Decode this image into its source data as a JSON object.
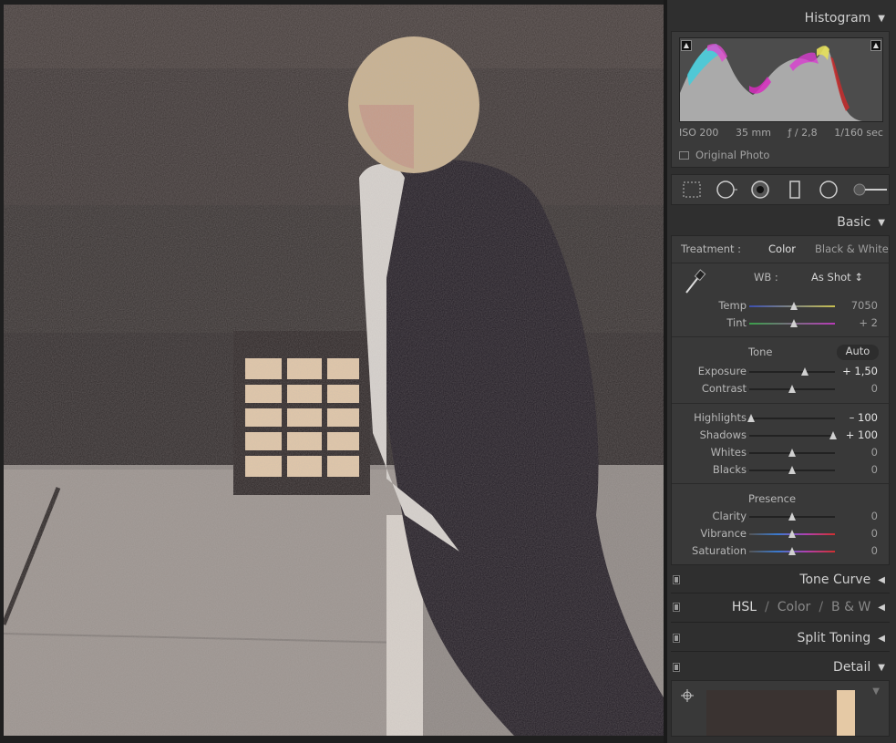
{
  "histogram": {
    "title": "Histogram",
    "exif": {
      "iso": "ISO 200",
      "focal": "35 mm",
      "aperture": "ƒ / 2,8",
      "shutter": "1/160 sec"
    },
    "original_photo_label": "Original Photo"
  },
  "basic": {
    "title": "Basic",
    "treatment_label": "Treatment :",
    "treatment_color": "Color",
    "treatment_bw": "Black & White",
    "wb_label": "WB :",
    "wb_value": "As Shot ↕",
    "tone_label": "Tone",
    "auto_label": "Auto",
    "presence_label": "Presence",
    "sliders": {
      "temp": {
        "label": "Temp",
        "value": "7050",
        "level": 0.52
      },
      "tint": {
        "label": "Tint",
        "value": "+ 2",
        "level": 0.52
      },
      "exposure": {
        "label": "Exposure",
        "value": "+ 1,50",
        "level": 0.65
      },
      "contrast": {
        "label": "Contrast",
        "value": "0",
        "level": 0.5
      },
      "highlights": {
        "label": "Highlights",
        "value": "– 100",
        "level": 0.02
      },
      "shadows": {
        "label": "Shadows",
        "value": "+ 100",
        "level": 0.98
      },
      "whites": {
        "label": "Whites",
        "value": "0",
        "level": 0.5
      },
      "blacks": {
        "label": "Blacks",
        "value": "0",
        "level": 0.5
      },
      "clarity": {
        "label": "Clarity",
        "value": "0",
        "level": 0.5
      },
      "vibrance": {
        "label": "Vibrance",
        "value": "0",
        "level": 0.5
      },
      "saturation": {
        "label": "Saturation",
        "value": "0",
        "level": 0.5
      }
    }
  },
  "panels": {
    "tone_curve": "Tone Curve",
    "hsl": "HSL",
    "color": "Color",
    "bw": "B & W",
    "hsl_sep": "/",
    "split_toning": "Split Toning",
    "detail": "Detail"
  },
  "colors": {
    "panel_bg": "#2f2f2f",
    "section_bg": "#393939",
    "text": "#b8b8b8"
  }
}
